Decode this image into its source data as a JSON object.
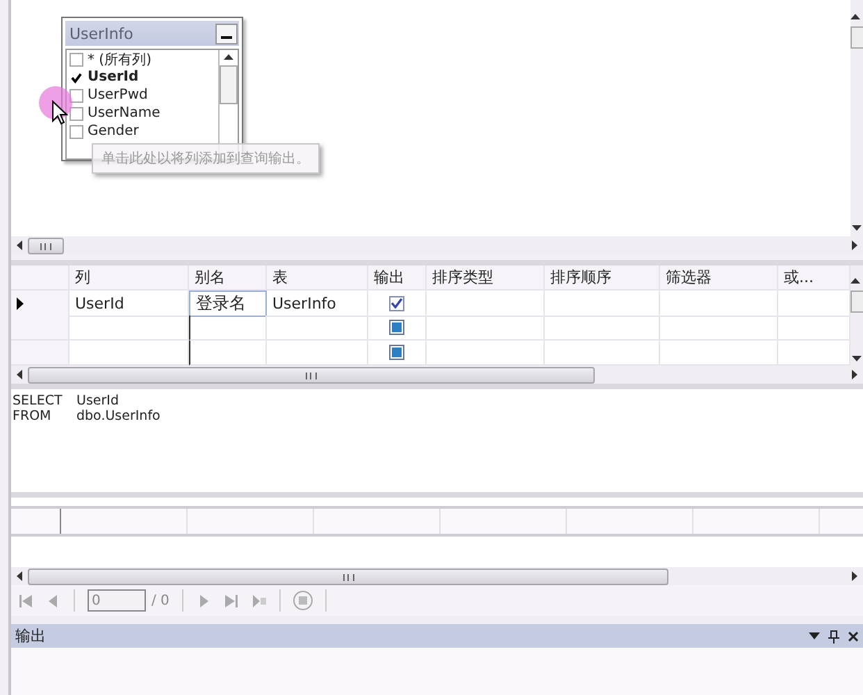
{
  "diagram": {
    "table": {
      "title": "UserInfo",
      "columns": [
        {
          "label": "* (所有列)",
          "checked": false
        },
        {
          "label": "UserId",
          "checked": true
        },
        {
          "label": "UserPwd",
          "checked": false
        },
        {
          "label": "UserName",
          "checked": false
        },
        {
          "label": "Gender",
          "checked": false
        }
      ]
    },
    "tooltip": "单击此处以将列添加到查询输出。"
  },
  "grid": {
    "columns": [
      "列",
      "别名",
      "表",
      "输出",
      "排序类型",
      "排序顺序",
      "筛选器",
      "或..."
    ],
    "rows": [
      {
        "kind": "filled",
        "current": true,
        "column": "UserId",
        "alias": "登录名",
        "table": "UserInfo",
        "output": true
      },
      {
        "kind": "new",
        "current": false,
        "output": false
      },
      {
        "kind": "new",
        "current": false,
        "output": false
      }
    ]
  },
  "sql": [
    {
      "keyword": "SELECT",
      "text": "UserId"
    },
    {
      "keyword": "FROM",
      "text": "dbo.UserInfo"
    }
  ],
  "navigator": {
    "record": "0",
    "total": "/ 0"
  },
  "output_panel": {
    "title": "输出"
  }
}
